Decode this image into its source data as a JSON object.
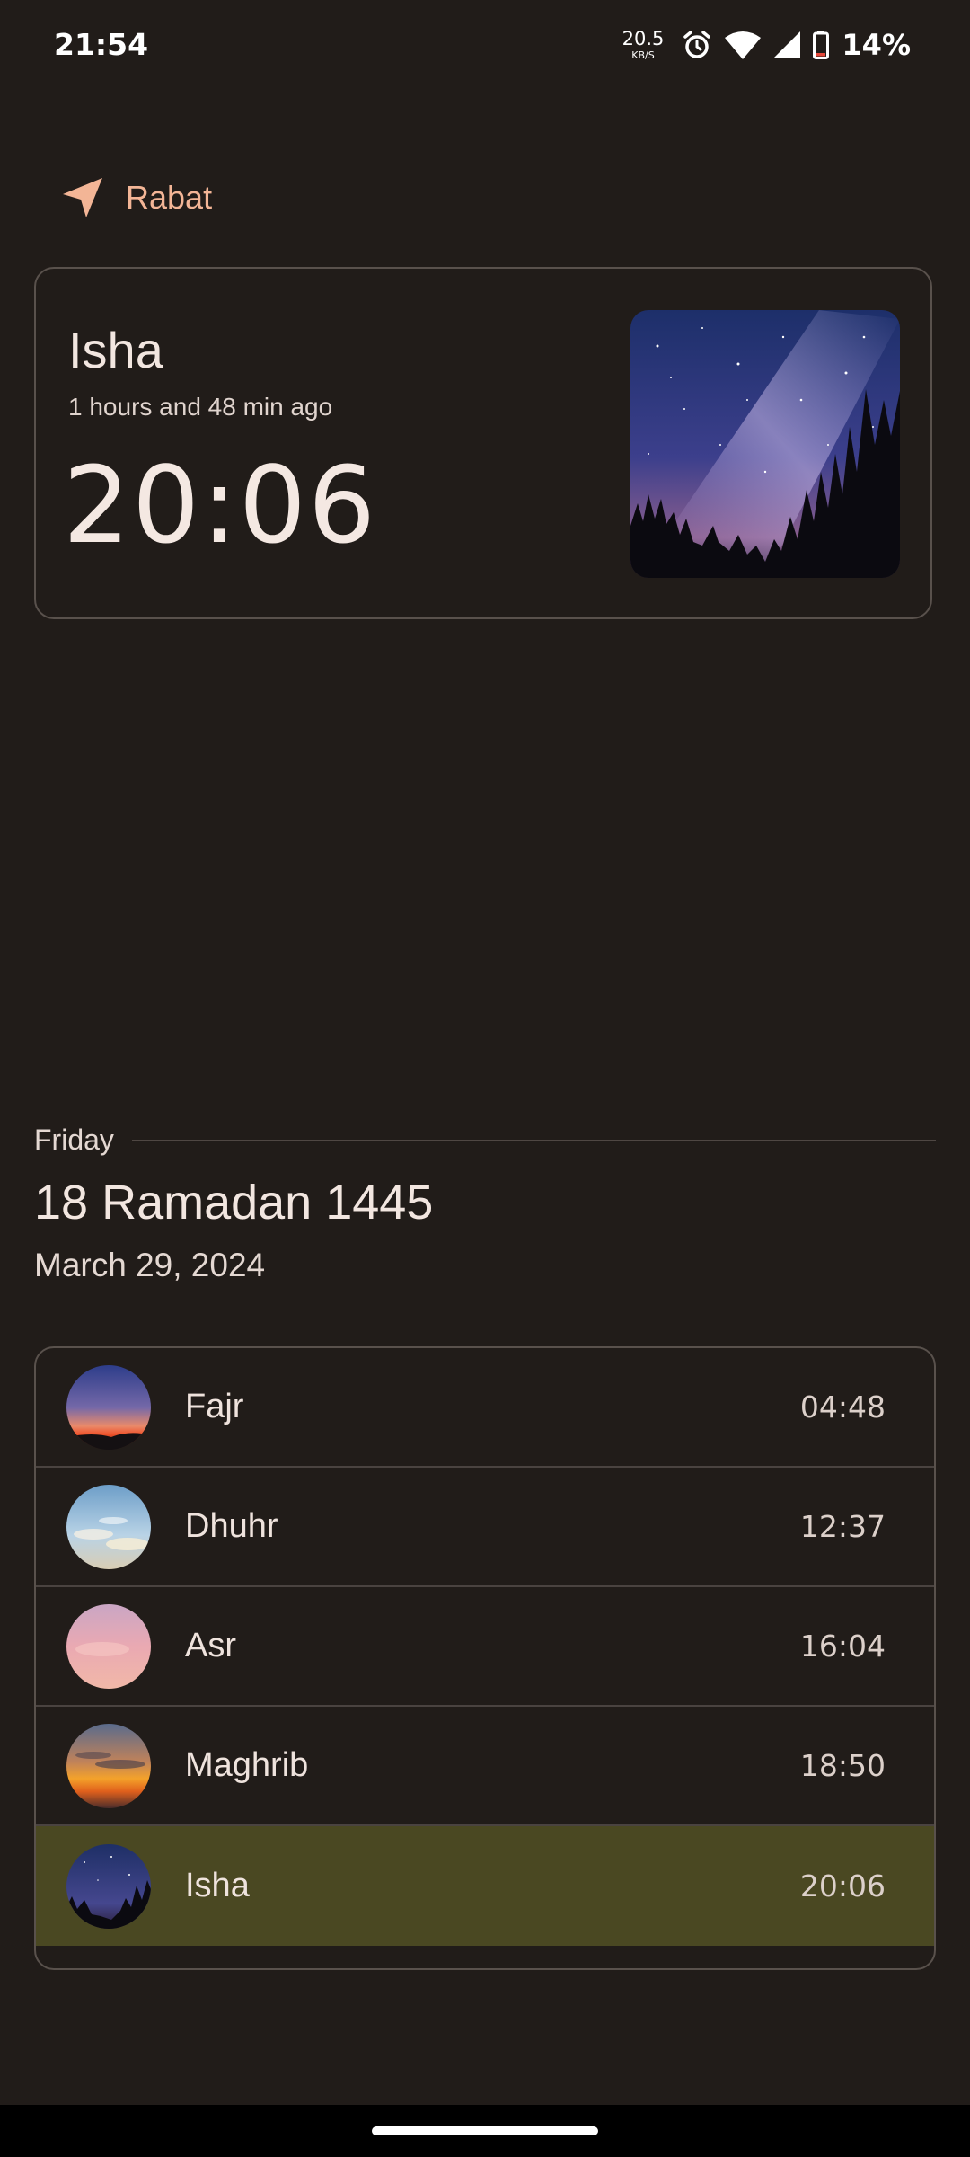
{
  "status_bar": {
    "time": "21:54",
    "net_speed_value": "20.5",
    "net_speed_unit": "KB/S",
    "battery_percent": "14%",
    "icons": [
      "alarm-icon",
      "wifi-icon",
      "cellular-signal-icon",
      "battery-low-icon"
    ]
  },
  "location": {
    "city": "Rabat",
    "icon": "navigation-arrow-icon",
    "accent_color": "#f3b596"
  },
  "current_prayer": {
    "name": "Isha",
    "elapsed": "1 hours and 48 min ago",
    "time": "20:06",
    "image": "night-sky-milky-way"
  },
  "date": {
    "weekday": "Friday",
    "hijri": "18 Ramadan 1445",
    "gregorian": "March 29, 2024"
  },
  "prayers": [
    {
      "name": "Fajr",
      "time": "04:48",
      "image": "dawn-sky"
    },
    {
      "name": "Dhuhr",
      "time": "12:37",
      "image": "daytime-clouds"
    },
    {
      "name": "Asr",
      "time": "16:04",
      "image": "pink-afternoon-sky"
    },
    {
      "name": "Maghrib",
      "time": "18:50",
      "image": "sunset"
    },
    {
      "name": "Isha",
      "time": "20:06",
      "image": "night-sky",
      "active": true
    }
  ],
  "colors": {
    "background": "#211c19",
    "active_row": "#4a4822",
    "border": "#59514c"
  }
}
